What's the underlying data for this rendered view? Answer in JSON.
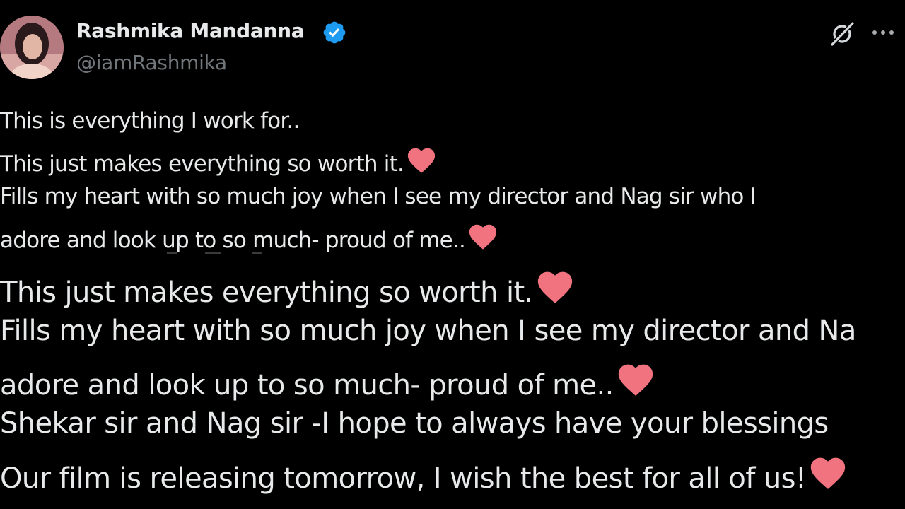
{
  "profile": {
    "display_name": "Rashmika Mandanna",
    "handle": "@iamRashmika",
    "verified": true,
    "verified_color": "#1d9bf0"
  },
  "icons": {
    "grok": "grok-icon",
    "more": "more-icon",
    "heart": "heart-emoji-icon"
  },
  "colors": {
    "background": "#000000",
    "text": "#e7e9ea",
    "secondary_text": "#71767b",
    "heart": "#f0737f"
  },
  "tweet": {
    "lines": [
      "This is everything I work for..",
      "This just makes everything so worth it.",
      "Fills my heart with so much joy when I see my director and Nag sir who I",
      "adore and look up to so much- proud of me.."
    ]
  },
  "zoomed": {
    "lines": [
      "This just makes everything so worth it.",
      "Fills my heart with so much joy when I see my director and Na",
      "adore and look up to so much- proud of me..",
      "Shekar sir and Nag sir -I hope to always  have your blessings",
      "Our film is releasing tomorrow, I wish the best for all of us!"
    ]
  }
}
